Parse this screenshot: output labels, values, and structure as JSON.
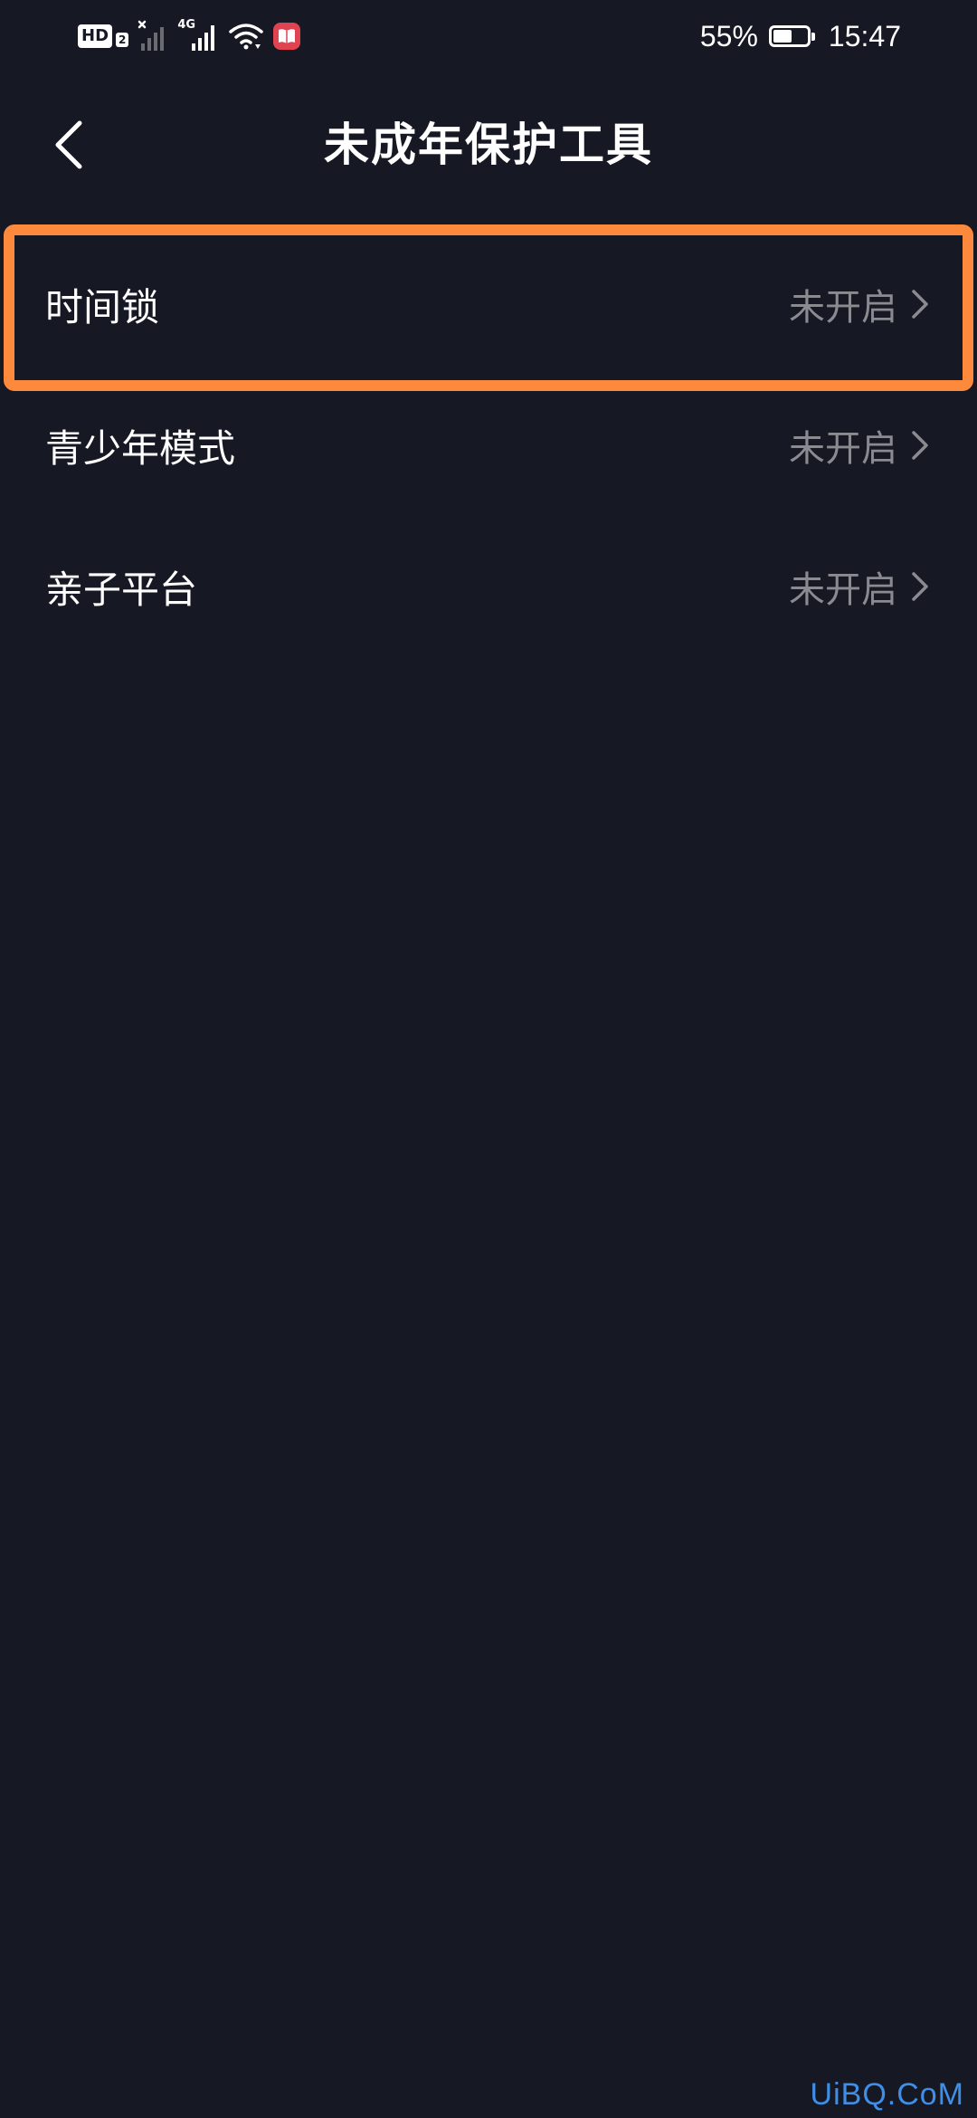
{
  "status_bar": {
    "hd_label": "HD",
    "hd_sub": "2",
    "network_label": "4G",
    "battery_percent": "55%",
    "battery_level": 0.55,
    "time": "15:47"
  },
  "nav": {
    "title": "未成年保护工具",
    "back_icon": "chevron-left-icon"
  },
  "list": {
    "items": [
      {
        "label": "时间锁",
        "status": "未开启"
      },
      {
        "label": "青少年模式",
        "status": "未开启"
      },
      {
        "label": "亲子平台",
        "status": "未开启"
      }
    ]
  },
  "colors": {
    "background": "#161823",
    "highlight": "#fd8a3c",
    "status_text": "#8a8b91",
    "watermark": "#3f8fe8"
  },
  "watermark": "UiBQ.CoM"
}
